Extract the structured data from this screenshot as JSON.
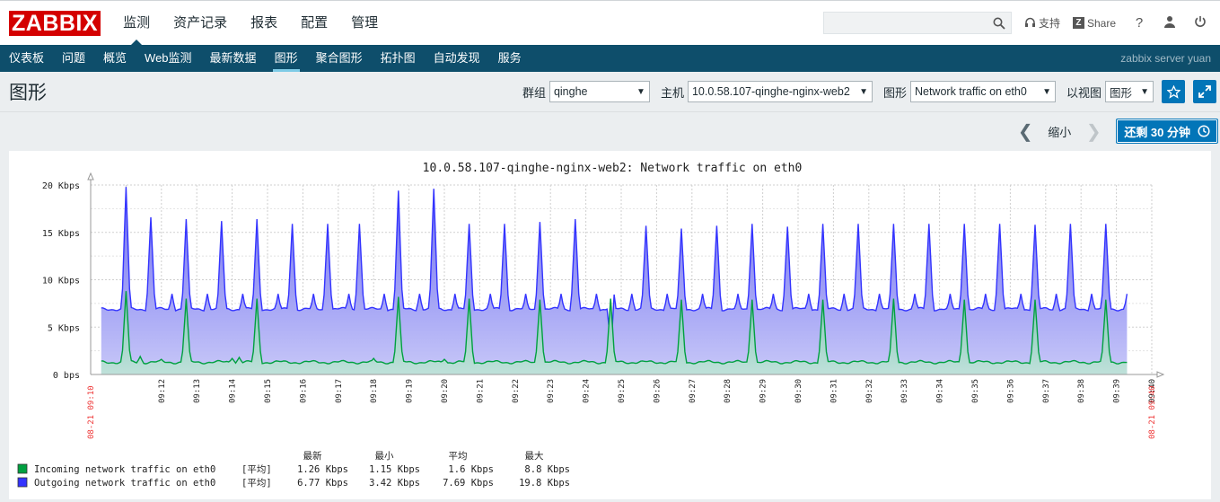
{
  "topbar": {
    "logo": "ZABBIX",
    "menu": [
      "监测",
      "资产记录",
      "报表",
      "配置",
      "管理"
    ],
    "support": "支持",
    "share": "Share",
    "help_icon": "question-icon",
    "user_icon": "user-icon",
    "logout_icon": "power-icon"
  },
  "submenu": {
    "items": [
      "仪表板",
      "问题",
      "概览",
      "Web监测",
      "最新数据",
      "图形",
      "聚合图形",
      "拓扑图",
      "自动发现",
      "服务"
    ],
    "server": "zabbix server yuan"
  },
  "header": {
    "title": "图形",
    "group_label": "群组",
    "group_value": "qinghe",
    "host_label": "主机",
    "host_value": "10.0.58.107-qinghe-nginx-web2",
    "graph_label": "图形",
    "graph_value": "Network traffic on eth0",
    "view_label": "以视图",
    "view_value": "图形"
  },
  "timebar": {
    "zoom_out": "缩小",
    "remaining": "还剩 30 分钟"
  },
  "colors": {
    "incoming": "#00a040",
    "outgoing": "#3333ff",
    "brand": "#d40000",
    "nav": "#0e4e6b"
  },
  "chart_data": {
    "type": "area",
    "title": "10.0.58.107-qinghe-nginx-web2: Network traffic on eth0",
    "ylim": [
      0,
      20
    ],
    "y_ticks": [
      "0 bps",
      "5 Kbps",
      "10 Kbps",
      "15 Kbps",
      "20 Kbps"
    ],
    "x_ticks": [
      "09:12",
      "09:13",
      "09:14",
      "09:15",
      "09:16",
      "09:17",
      "09:18",
      "09:19",
      "09:20",
      "09:21",
      "09:22",
      "09:23",
      "09:24",
      "09:25",
      "09:26",
      "09:27",
      "09:28",
      "09:29",
      "09:30",
      "09:31",
      "09:32",
      "09:33",
      "09:34",
      "09:35",
      "09:36",
      "09:37",
      "09:38",
      "09:39",
      "09:40"
    ],
    "x_start": "08-21 09:10",
    "x_end": "08-21 09:40",
    "x_range_minutes": [
      0,
      30
    ],
    "baseline": {
      "outgoing": 6.9,
      "incoming": 1.3
    },
    "outgoing_spikes": [
      [
        1.0,
        19.8
      ],
      [
        1.7,
        16.6
      ],
      [
        2.7,
        16.4
      ],
      [
        3.7,
        16.2
      ],
      [
        4.7,
        16.4
      ],
      [
        5.7,
        15.9
      ],
      [
        6.7,
        15.9
      ],
      [
        7.6,
        15.9
      ],
      [
        8.7,
        19.4
      ],
      [
        9.7,
        19.6
      ],
      [
        10.7,
        15.9
      ],
      [
        11.7,
        15.9
      ],
      [
        12.7,
        16.1
      ],
      [
        13.7,
        16.4
      ],
      [
        14.7,
        16.1
      ],
      [
        15.7,
        15.7
      ],
      [
        16.7,
        15.4
      ],
      [
        17.7,
        15.7
      ],
      [
        18.7,
        15.9
      ],
      [
        19.7,
        15.6
      ],
      [
        20.7,
        15.9
      ],
      [
        21.7,
        15.9
      ],
      [
        22.7,
        15.9
      ],
      [
        23.7,
        15.9
      ],
      [
        24.7,
        15.9
      ],
      [
        25.7,
        15.9
      ],
      [
        26.7,
        15.8
      ],
      [
        27.7,
        15.9
      ],
      [
        28.7,
        15.9
      ]
    ],
    "incoming_spikes": [
      [
        1.0,
        8.8
      ],
      [
        2.7,
        8.0
      ],
      [
        4.7,
        8.0
      ],
      [
        8.7,
        8.2
      ],
      [
        10.7,
        8.0
      ],
      [
        12.7,
        7.9
      ],
      [
        14.7,
        8.0
      ],
      [
        16.7,
        7.9
      ],
      [
        18.7,
        7.9
      ],
      [
        20.7,
        7.9
      ],
      [
        22.7,
        8.0
      ],
      [
        24.7,
        7.9
      ],
      [
        26.7,
        7.9
      ],
      [
        28.7,
        7.9
      ]
    ],
    "outgoing_dip": [
      14.7,
      3.4
    ],
    "legend_headers": [
      "最新",
      "最小",
      "平均",
      "最大"
    ],
    "series": [
      {
        "name": "Incoming network traffic on eth0",
        "agg": "[平均]",
        "last": "1.26 Kbps",
        "min": "1.15 Kbps",
        "avg": "1.6 Kbps",
        "max": "8.8 Kbps",
        "color": "#00a040"
      },
      {
        "name": "Outgoing network traffic on eth0",
        "agg": "[平均]",
        "last": "6.77 Kbps",
        "min": "3.42 Kbps",
        "avg": "7.69 Kbps",
        "max": "19.8 Kbps",
        "color": "#3333ff"
      }
    ]
  }
}
